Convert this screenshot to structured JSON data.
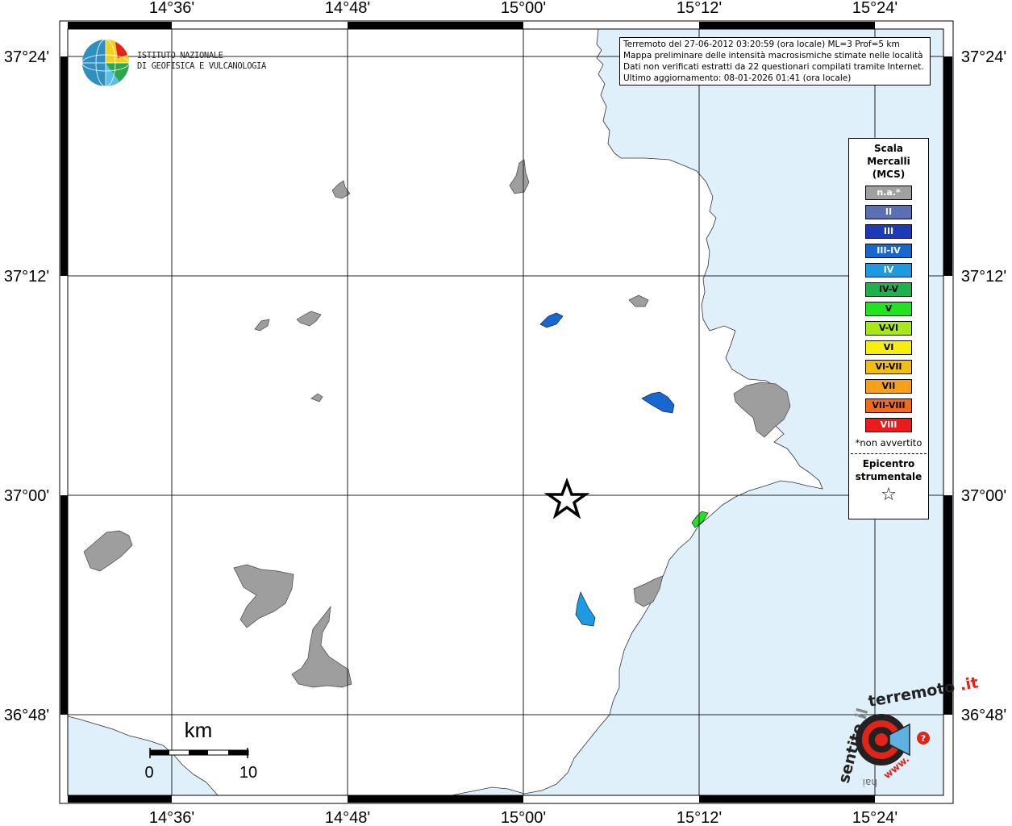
{
  "map": {
    "lon_labels": [
      "14°36'",
      "14°48'",
      "15°00'",
      "15°12'",
      "15°24'"
    ],
    "lat_labels": [
      "37°24'",
      "37°12'",
      "37°00'",
      "36°48'"
    ],
    "colors": {
      "sea": "#dff0fa",
      "land": "#ffffff",
      "grid": "#222222",
      "urban_na": "#9e9e9e"
    }
  },
  "info": {
    "line1": "Terremoto del 27-06-2012 03:20:59 (ora locale) ML=3 Prof=5 km",
    "line2": "Mappa preliminare delle intensità macrosismiche stimate nelle località",
    "line3": "Dati non verificati estratti da 22 questionari compilati tramite Internet.",
    "line4": "Ultimo aggiornamento: 08-01-2026 01:41 (ora locale)"
  },
  "logo": {
    "line1": "ISTITUTO NAZIONALE",
    "line2": "DI GEOFISICA E VULCANOLOGIA"
  },
  "legend": {
    "title1": "Scala",
    "title2": "Mercalli",
    "title3": "(MCS)",
    "items": [
      {
        "label": "n.a.*",
        "color": "#a0a0a0"
      },
      {
        "label": "II",
        "color": "#5b6fb5"
      },
      {
        "label": "III",
        "color": "#1c39b8"
      },
      {
        "label": "III-IV",
        "color": "#1668d0"
      },
      {
        "label": "IV",
        "color": "#1c9be0"
      },
      {
        "label": "IV-V",
        "color": "#1db24e"
      },
      {
        "label": "V",
        "color": "#22e222"
      },
      {
        "label": "V-VI",
        "color": "#a8e816"
      },
      {
        "label": "VI",
        "color": "#f7ef0a"
      },
      {
        "label": "VI-VII",
        "color": "#f3be12"
      },
      {
        "label": "VII",
        "color": "#f7a11a"
      },
      {
        "label": "VII-VIII",
        "color": "#f26b1b"
      },
      {
        "label": "VIII",
        "color": "#ec1b1b"
      }
    ],
    "note": "*non avvertito",
    "epi1": "Epicentro",
    "epi2": "strumentale",
    "epi_symbol": "☆"
  },
  "scale": {
    "unit": "km",
    "min": "0",
    "max": "10"
  },
  "site_logo": {
    "text1": "hai",
    "text2": "sentito",
    "text3": "il",
    "text4": "terremoto",
    "text5": ".it",
    "text6": "www."
  }
}
